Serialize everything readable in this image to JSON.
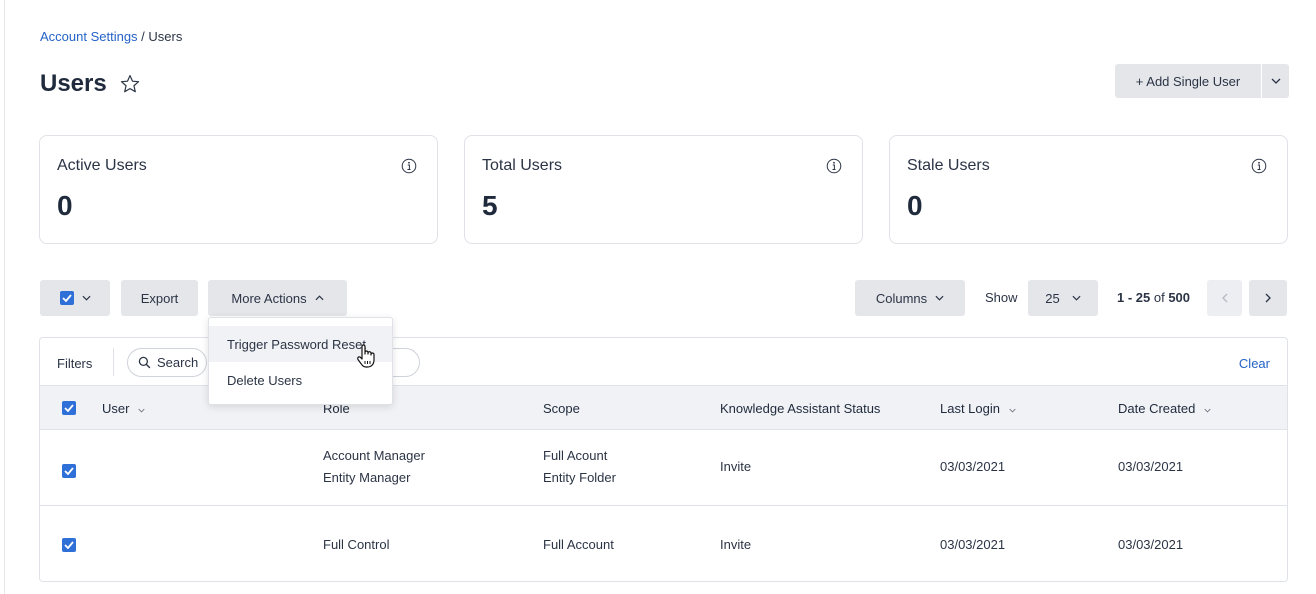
{
  "breadcrumb": {
    "parent": "Account Settings",
    "separator": " / ",
    "current": "Users"
  },
  "page": {
    "title": "Users"
  },
  "actions": {
    "add_user_label": "+ Add Single User"
  },
  "cards": [
    {
      "label": "Active Users",
      "value": "0"
    },
    {
      "label": "Total Users",
      "value": "5"
    },
    {
      "label": "Stale Users",
      "value": "0"
    }
  ],
  "toolbar": {
    "export_label": "Export",
    "more_actions_label": "More Actions",
    "columns_label": "Columns",
    "show_label": "Show",
    "page_size": "25",
    "range_text": "1 - 25",
    "range_of": " of ",
    "range_total": "500"
  },
  "more_actions_menu": {
    "items": [
      "Trigger Password Reset",
      "Delete Users"
    ]
  },
  "filters": {
    "label": "Filters",
    "search_label": "Search",
    "user_chip_partial": "er",
    "clear_label": "Clear"
  },
  "table": {
    "columns": {
      "user": "User",
      "role": "Role",
      "scope": "Scope",
      "ka_status": "Knowledge Assistant Status",
      "last_login": "Last Login",
      "date_created": "Date Created"
    },
    "rows": [
      {
        "role_1": "Account Manager",
        "role_2": "Entity Manager",
        "scope_1": "Full Acount",
        "scope_2": "Entity Folder",
        "ka_status": "Invite",
        "last_login": "03/03/2021",
        "date_created": "03/03/2021"
      },
      {
        "role_1": "Full Control",
        "scope_1": "Full Account",
        "ka_status": "Invite",
        "last_login": "03/03/2021",
        "date_created": "03/03/2021"
      }
    ]
  },
  "colors": {
    "accent": "#2f6fd8",
    "link": "#2463c7",
    "button_bg": "#e4e6ea",
    "header_bg": "#f1f2f5"
  },
  "icons": [
    "star-outline-icon",
    "chevron-down-icon",
    "info-icon",
    "checkbox-checked-icon",
    "chevron-up-icon",
    "chevron-left-icon",
    "chevron-right-icon",
    "search-icon",
    "hand-cursor-icon"
  ]
}
